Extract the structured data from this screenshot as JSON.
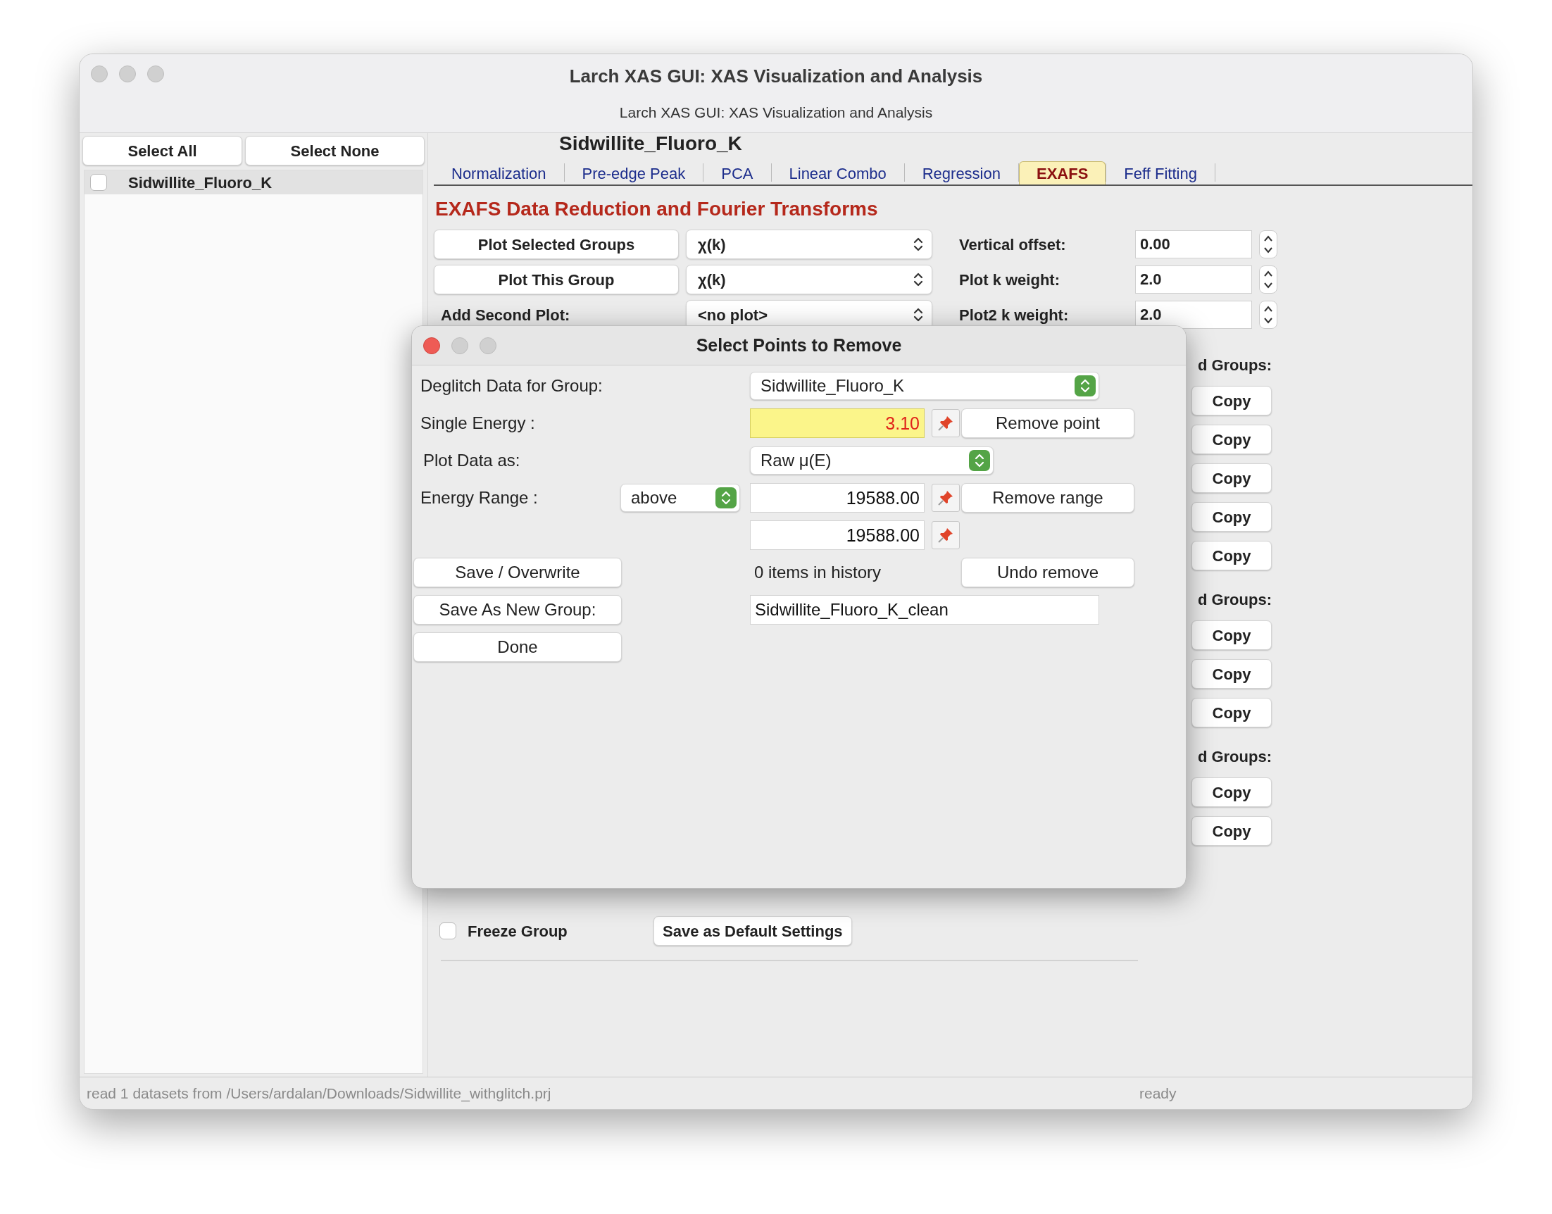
{
  "window": {
    "title": "Larch XAS GUI: XAS Visualization and Analysis",
    "subtitle": "Larch XAS GUI: XAS Visualization and Analysis"
  },
  "sidebar": {
    "buttons": [
      "Select All",
      "Select None"
    ],
    "groups": [
      {
        "label": "Sidwillite_Fluoro_K",
        "checked": false,
        "selected": true
      }
    ]
  },
  "main": {
    "group_title": "Sidwillite_Fluoro_K",
    "tabs": [
      {
        "label": "Normalization",
        "selected": false
      },
      {
        "label": "Pre-edge Peak",
        "selected": false
      },
      {
        "label": "PCA",
        "selected": false
      },
      {
        "label": "Linear Combo",
        "selected": false
      },
      {
        "label": "Regression",
        "selected": false
      },
      {
        "label": "EXAFS",
        "selected": true
      },
      {
        "label": "Feff Fitting",
        "selected": false
      }
    ],
    "heading": "EXAFS Data Reduction and Fourier Transforms",
    "plot_rows": [
      {
        "kind": "button",
        "label": "Plot Selected Groups",
        "choice": "χ(k)",
        "setting_label": "Vertical offset:",
        "setting_value": "0.00"
      },
      {
        "kind": "button",
        "label": "Plot This Group",
        "choice": "χ(k)",
        "setting_label": "Plot k weight:",
        "setting_value": "2.0"
      },
      {
        "kind": "label",
        "label": "Add Second Plot:",
        "choice": "<no plot>",
        "setting_label": "Plot2 k weight:",
        "setting_value": "2.0"
      }
    ],
    "copy_sections": [
      {
        "label": "d Groups:",
        "buttons": [
          "Copy",
          "Copy",
          "Copy",
          "Copy",
          "Copy"
        ]
      },
      {
        "label": "d Groups:",
        "buttons": [
          "Copy",
          "Copy",
          "Copy"
        ]
      },
      {
        "label": "d Groups:",
        "buttons": [
          "Copy",
          "Copy"
        ]
      }
    ],
    "freeze": {
      "label": "Freeze Group",
      "checked": false
    },
    "default_button": "Save as Default Settings"
  },
  "dialog": {
    "title": "Select Points to Remove",
    "group_label": "Deglitch Data for Group:",
    "group_choice": "Sidwillite_Fluoro_K",
    "single_label": "Single Energy :",
    "single_value": "3.10",
    "single_highlighted": true,
    "remove_point": "Remove point",
    "plot_label": "Plot Data as:",
    "plot_choice": "Raw μ(E)",
    "range_label": "Energy Range :",
    "range_mode": "above",
    "range_values": [
      "19588.00",
      "19588.00"
    ],
    "remove_range": "Remove range",
    "save_overwrite": "Save / Overwrite",
    "history": "0 items in history",
    "undo": "Undo remove",
    "save_new": "Save As New Group:",
    "new_name": "Sidwillite_Fluoro_K_clean",
    "done": "Done"
  },
  "status_bar": {
    "message": "read 1 datasets from /Users/ardalan/Downloads/Sidwillite_withglitch.prj",
    "state": "ready"
  }
}
